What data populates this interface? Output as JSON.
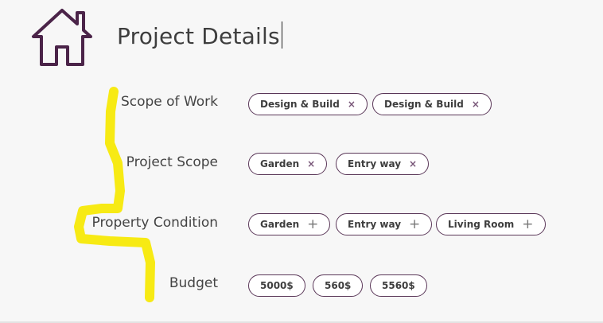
{
  "header": {
    "title": "Project Details",
    "home_icon": "home-icon"
  },
  "rows": {
    "scope_of_work": {
      "label": "Scope of Work",
      "chips": [
        "Design & Build",
        "Design & Build"
      ],
      "chip_action": "remove"
    },
    "project_scope": {
      "label": "Project Scope",
      "chips": [
        "Garden",
        "Entry way"
      ],
      "chip_action": "remove"
    },
    "property_condition": {
      "label": "Property Condition",
      "chips": [
        "Garden",
        "Entry way",
        "Living Room"
      ],
      "chip_action": "add"
    },
    "budget": {
      "label": "Budget",
      "chips": [
        "5000$",
        "560$",
        "5560$"
      ],
      "chip_action": "none"
    }
  },
  "icons": {
    "remove": "×",
    "add": "+"
  },
  "colors": {
    "accent": "#4b2449",
    "highlight": "#f6e800",
    "background": "#f7f7f7"
  }
}
